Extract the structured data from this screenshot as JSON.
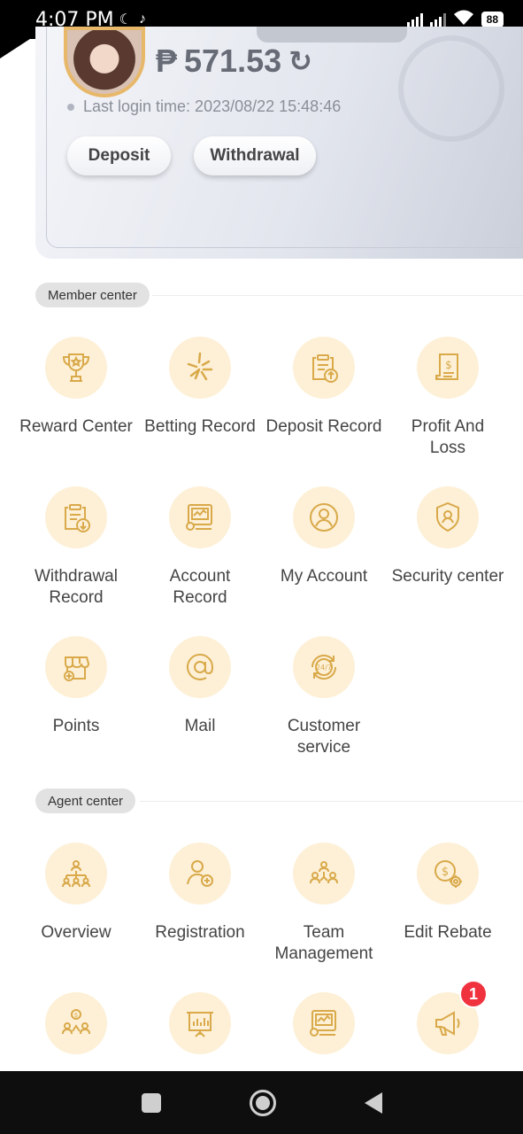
{
  "status_bar": {
    "time": "4:07 PM",
    "battery": "88"
  },
  "account": {
    "currency_symbol": "₱",
    "balance": "571.53",
    "last_login": "Last login time: 2023/08/22 15:48:46",
    "deposit_label": "Deposit",
    "withdrawal_label": "Withdrawal"
  },
  "member_center": {
    "title": "Member center",
    "items": [
      {
        "label": "Reward Center",
        "icon": "trophy-icon"
      },
      {
        "label": "Betting Record",
        "icon": "sparkle-icon"
      },
      {
        "label": "Deposit Record",
        "icon": "clipboard-upload-icon"
      },
      {
        "label": "Profit And Loss",
        "icon": "receipt-icon"
      },
      {
        "label": "Withdrawal Record",
        "icon": "clipboard-download-icon"
      },
      {
        "label": "Account Record",
        "icon": "monitor-chart-icon"
      },
      {
        "label": "My Account",
        "icon": "user-circle-icon"
      },
      {
        "label": "Security center",
        "icon": "shield-user-icon"
      },
      {
        "label": "Points",
        "icon": "store-icon"
      },
      {
        "label": "Mail",
        "icon": "at-sign-icon"
      },
      {
        "label": "Customer service",
        "icon": "support-24-7-icon"
      }
    ]
  },
  "agent_center": {
    "title": "Agent center",
    "items": [
      {
        "label": "Overview",
        "icon": "org-chart-icon"
      },
      {
        "label": "Registration",
        "icon": "add-user-icon"
      },
      {
        "label": "Team Management",
        "icon": "team-icon"
      },
      {
        "label": "Edit Rebate",
        "icon": "coin-gear-icon"
      },
      {
        "label": "",
        "icon": "team-money-icon"
      },
      {
        "label": "",
        "icon": "presentation-chart-icon"
      },
      {
        "label": "",
        "icon": "monitor-chart-icon"
      },
      {
        "label": "",
        "icon": "megaphone-icon",
        "badge": "1"
      }
    ]
  }
}
